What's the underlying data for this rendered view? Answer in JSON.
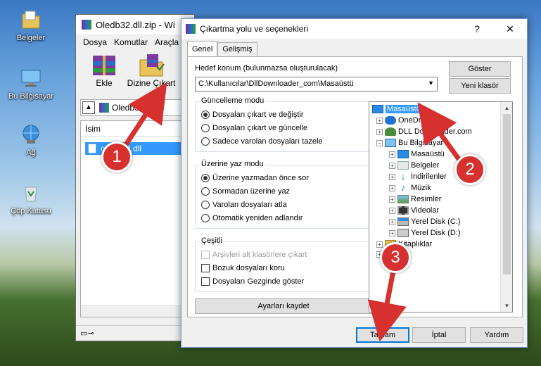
{
  "desktop": {
    "icons": [
      {
        "label": "Belgeler",
        "icon": "documents-folder-icon"
      },
      {
        "label": "Bu Bilgisayar",
        "icon": "this-pc-icon"
      },
      {
        "label": "Ağ",
        "icon": "network-icon"
      },
      {
        "label": "Çöp Kutusu",
        "icon": "recycle-bin-icon"
      }
    ]
  },
  "winrar": {
    "title": "Oledb32.dll.zip - Wi",
    "menu": [
      "Dosya",
      "Komutlar",
      "Araçla"
    ],
    "toolbar": {
      "add": "Ekle",
      "extract": "Dizine Çıkart"
    },
    "address": "Oledb32.dll",
    "column_name": "İsim",
    "selected_file": "oledb32.dll"
  },
  "dialog": {
    "title": "Çıkartma yolu ve seçenekleri",
    "help_button": "?",
    "close_button": "✕",
    "tabs": [
      "Genel",
      "Gelişmiş"
    ],
    "destination_label": "Hedef konum (bulunmazsa oluşturulacak)",
    "destination_value": "C:\\Kullanıcılar\\DllDownloader_com\\Masaüstü",
    "show_button": "Göster",
    "new_folder_button": "Yeni klasör",
    "update_mode": {
      "title": "Güncelleme modu",
      "options": [
        "Dosyaları çıkart ve değiştir",
        "Dosyaları çıkart ve güncelle",
        "Sadece varolan dosyaları tazele"
      ],
      "selected": 0
    },
    "overwrite_mode": {
      "title": "Üzerine yaz modu",
      "options": [
        "Üzerine yazmadan önce sor",
        "Sormadan üzerine yaz",
        "Varolan dosyaları atla",
        "Otomatik yeniden adlandır"
      ],
      "selected": 0
    },
    "misc": {
      "title": "Çeşitli",
      "options": [
        "Arşivleri alt klasörlere çıkart",
        "Bozuk dosyaları koru",
        "Dosyaları Gezginde göster"
      ]
    },
    "save_settings_button": "Ayarları kaydet",
    "tree": {
      "root": "Masaüstü",
      "items": [
        "OneDrive",
        "DLL Downloader.com",
        "Bu Bilgisayar",
        "Masaüstü",
        "Belgeler",
        "İndirilenler",
        "Müzik",
        "Resimler",
        "Videolar",
        "Yerel Disk (C:)",
        "Yerel Disk (D:)",
        "Kitaplıklar"
      ]
    },
    "ok_button": "Tamam",
    "cancel_button": "İptal",
    "help_text_button": "Yardım"
  },
  "annotations": {
    "step1": "1",
    "step2": "2",
    "step3": "3"
  },
  "colors": {
    "badge": "#d6302f",
    "selection": "#3399ff",
    "accent": "#0078d7"
  }
}
